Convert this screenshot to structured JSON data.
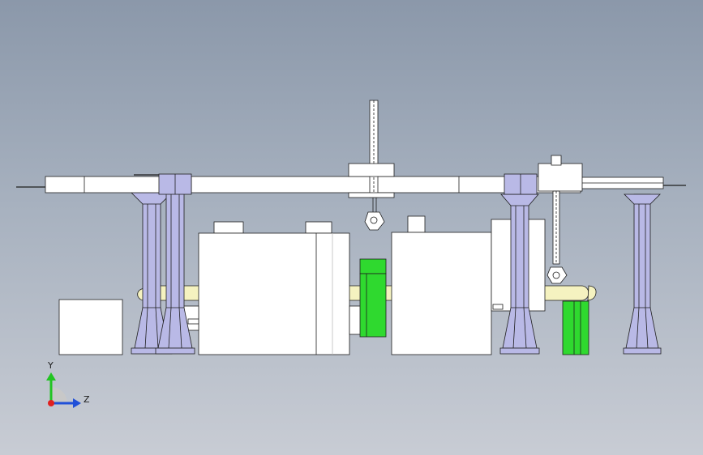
{
  "triad": {
    "y_label": "Y",
    "z_label": "Z"
  },
  "colors": {
    "background_top": "#8b98aa",
    "background_bottom": "#c8ccd4",
    "column": "#b9b9e6",
    "column_edge": "#3a3a6a",
    "beam": "#ffffff",
    "pipe": "#f5f2c0",
    "green_part": "#2fd92f",
    "line": "#1e1e1e"
  }
}
